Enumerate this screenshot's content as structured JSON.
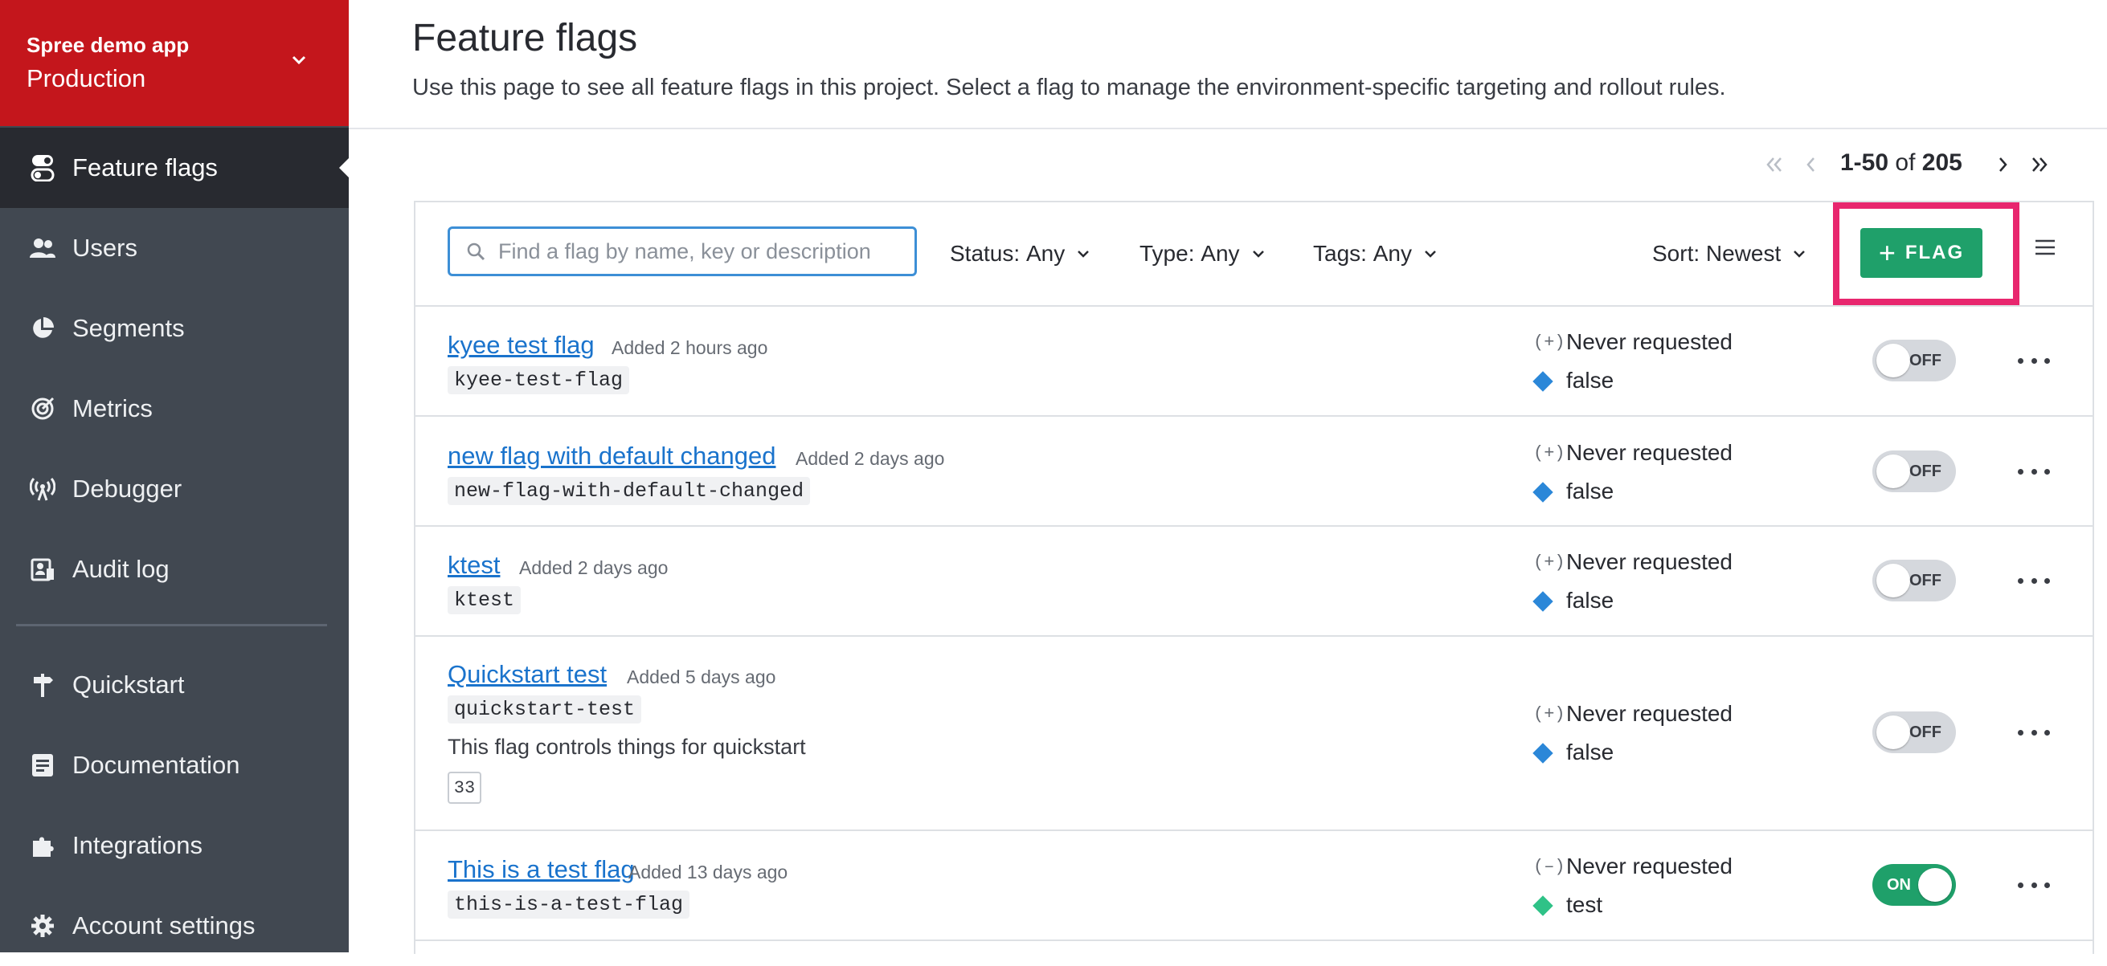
{
  "project": {
    "name": "Spree demo app",
    "environment": "Production"
  },
  "nav": [
    {
      "label": "Feature flags",
      "icon": "toggle-icon",
      "active": true
    },
    {
      "label": "Users",
      "icon": "users-icon"
    },
    {
      "label": "Segments",
      "icon": "pie-chart-icon"
    },
    {
      "label": "Metrics",
      "icon": "target-icon"
    },
    {
      "label": "Debugger",
      "icon": "broadcast-icon"
    },
    {
      "label": "Audit log",
      "icon": "audit-log-icon"
    },
    {
      "label": "Quickstart",
      "icon": "signpost-icon"
    },
    {
      "label": "Documentation",
      "icon": "document-icon"
    },
    {
      "label": "Integrations",
      "icon": "puzzle-icon"
    },
    {
      "label": "Account settings",
      "icon": "gear-icon"
    }
  ],
  "header": {
    "title": "Feature flags",
    "description": "Use this page to see all feature flags in this project. Select a flag to manage the environment-specific targeting and rollout rules."
  },
  "pagination": {
    "range": "1-50",
    "of": "of",
    "total": "205"
  },
  "toolbar": {
    "search_placeholder": "Find a flag by name, key or description",
    "status_label": "Status:",
    "status_value": "Any",
    "type_label": "Type:",
    "type_value": "Any",
    "tags_label": "Tags:",
    "tags_value": "Any",
    "sort_label": "Sort:",
    "sort_value": "Newest",
    "add_button": "FLAG"
  },
  "flags": [
    {
      "name": "kyee test flag",
      "added": "Added 2 hours ago",
      "key": "kyee-test-flag",
      "eval_icon": "(+)",
      "eval": "Never requested",
      "variation": "false",
      "variation_color": "#2b87d8",
      "toggle": "OFF"
    },
    {
      "name": "new flag with default changed",
      "added": "Added 2 days ago",
      "key": "new-flag-with-default-changed",
      "eval_icon": "(+)",
      "eval": "Never requested",
      "variation": "false",
      "variation_color": "#2b87d8",
      "toggle": "OFF"
    },
    {
      "name": "ktest",
      "added": "Added 2 days ago",
      "key": "ktest",
      "eval_icon": "(+)",
      "eval": "Never requested",
      "variation": "false",
      "variation_color": "#2b87d8",
      "toggle": "OFF"
    },
    {
      "name": "Quickstart test",
      "added": "Added 5 days ago",
      "key": "quickstart-test",
      "description": "This flag controls things for quickstart",
      "tag_count": "33",
      "eval_icon": "(+)",
      "eval": "Never requested",
      "variation": "false",
      "variation_color": "#2b87d8",
      "toggle": "OFF"
    },
    {
      "name": "This is a test flag",
      "added": "Added 13 days ago",
      "key": "this-is-a-test-flag",
      "eval_icon": "(–)",
      "eval": "Never requested",
      "variation": "test",
      "variation_color": "#2fc287",
      "toggle": "ON"
    }
  ],
  "colors": {
    "brand": "#c4161c",
    "sidebar": "#414851",
    "accent": "#1fa06a",
    "link": "#1a73cc",
    "highlight": "#e8266e"
  }
}
